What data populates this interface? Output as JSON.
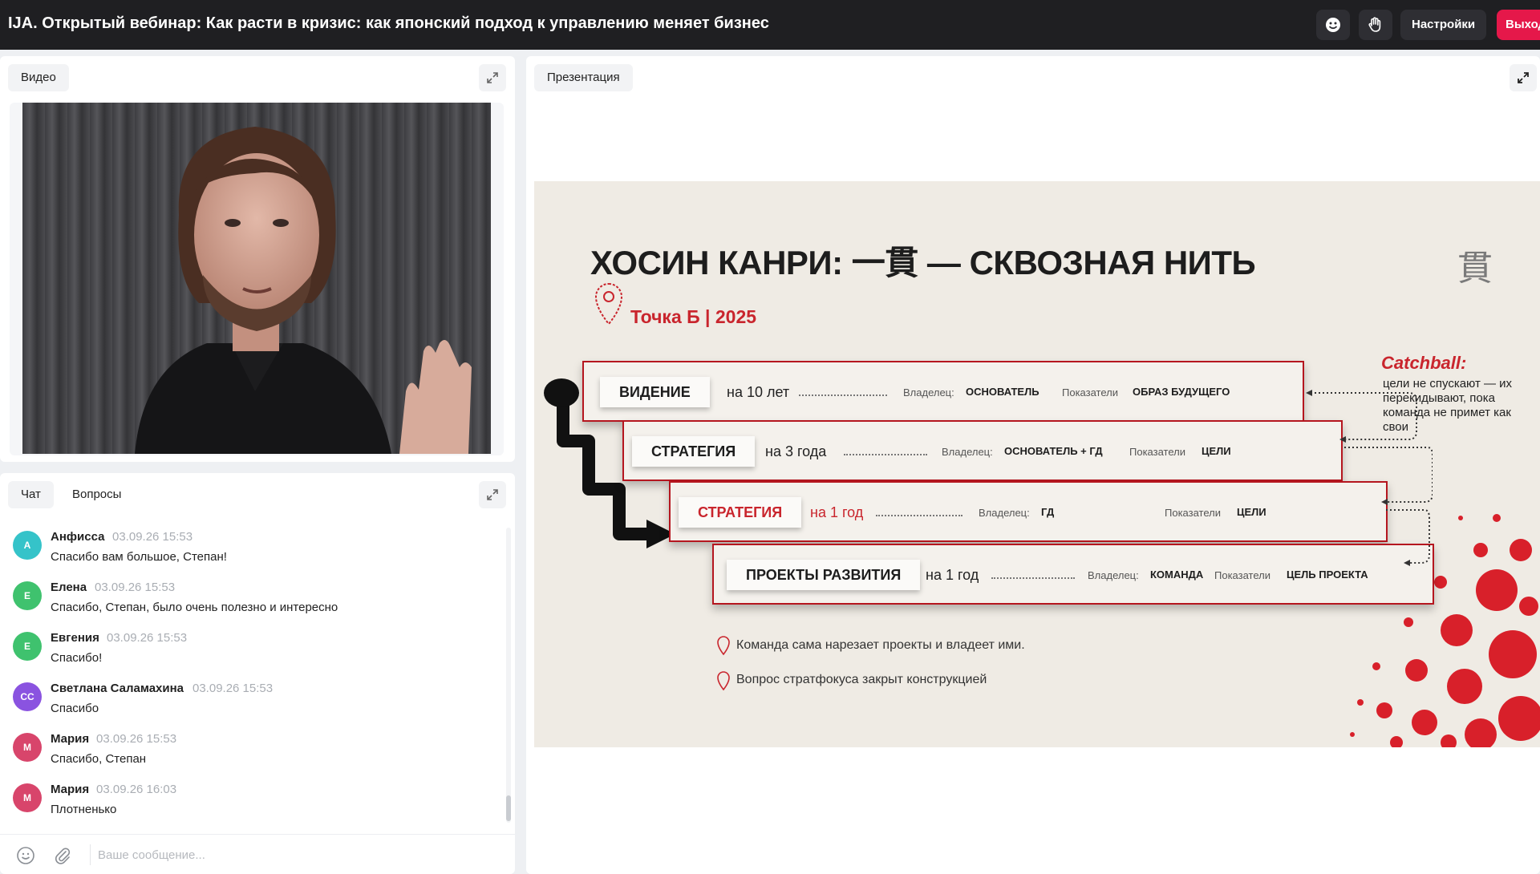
{
  "header": {
    "title": "IJA. Открытый вебинар: Как расти в кризис: как японский подход к управлению меняет бизнес",
    "settings_label": "Настройки",
    "exit_label": "Выход"
  },
  "video": {
    "tab_label": "Видео"
  },
  "chat": {
    "tabs": [
      "Чат",
      "Вопросы"
    ],
    "messages": [
      {
        "initials": "А",
        "name": "Анфисса",
        "time": "03.09.26 15:53",
        "text": "Спасибо вам большое, Степан!",
        "color": "#35c3c9"
      },
      {
        "initials": "Е",
        "name": "Елена",
        "time": "03.09.26 15:53",
        "text": "Спасибо, Степан, было очень полезно и интересно",
        "color": "#3fc26e"
      },
      {
        "initials": "Е",
        "name": "Евгения",
        "time": "03.09.26 15:53",
        "text": "Спасибо!",
        "color": "#3fc26e"
      },
      {
        "initials": "СС",
        "name": "Светлана Саламахина",
        "time": "03.09.26 15:53",
        "text": "Спасибо",
        "color": "#8a53e0"
      },
      {
        "initials": "М",
        "name": "Мария",
        "time": "03.09.26 15:53",
        "text": "Спасибо, Степан",
        "color": "#d8456b"
      },
      {
        "initials": "М",
        "name": "Мария",
        "time": "03.09.26 16:03",
        "text": "Плотненько",
        "color": "#d8456b"
      }
    ],
    "input_placeholder": "Ваше сообщение..."
  },
  "presentation": {
    "tab_label": "Презентация",
    "slide": {
      "title": "ХОСИН КАНРИ: 一貫 — СКВОЗНАЯ НИТЬ",
      "kanji": "貫",
      "subtitle": "Точка Б | 2025",
      "owner_key": "Владелец:",
      "metrics_key": "Показатели",
      "levels": [
        {
          "label": "ВИДЕНИЕ",
          "horizon": "на 10 лет",
          "owner": "ОСНОВАТЕЛЬ",
          "metric": "ОБРАЗ БУДУЩЕГО"
        },
        {
          "label": "СТРАТЕГИЯ",
          "horizon": "на 3 года",
          "owner": "ОСНОВАТЕЛЬ + ГД",
          "metric": "ЦЕЛИ"
        },
        {
          "label": "СТРАТЕГИЯ",
          "horizon": "на 1 год",
          "owner": "ГД",
          "metric": "ЦЕЛИ"
        },
        {
          "label": "ПРОЕКТЫ РАЗВИТИЯ",
          "horizon": "на 1 год",
          "owner": "КОМАНДА",
          "metric": "ЦЕЛЬ ПРОЕКТА"
        }
      ],
      "catchball_title": "Catchball:",
      "catchball_text": "цели не спускают — их перекидывают, пока команда не примет как свои",
      "notes": [
        "Команда сама нарезает проекты и владеет ими.",
        "Вопрос стратфокуса закрыт конструкцией"
      ]
    }
  }
}
